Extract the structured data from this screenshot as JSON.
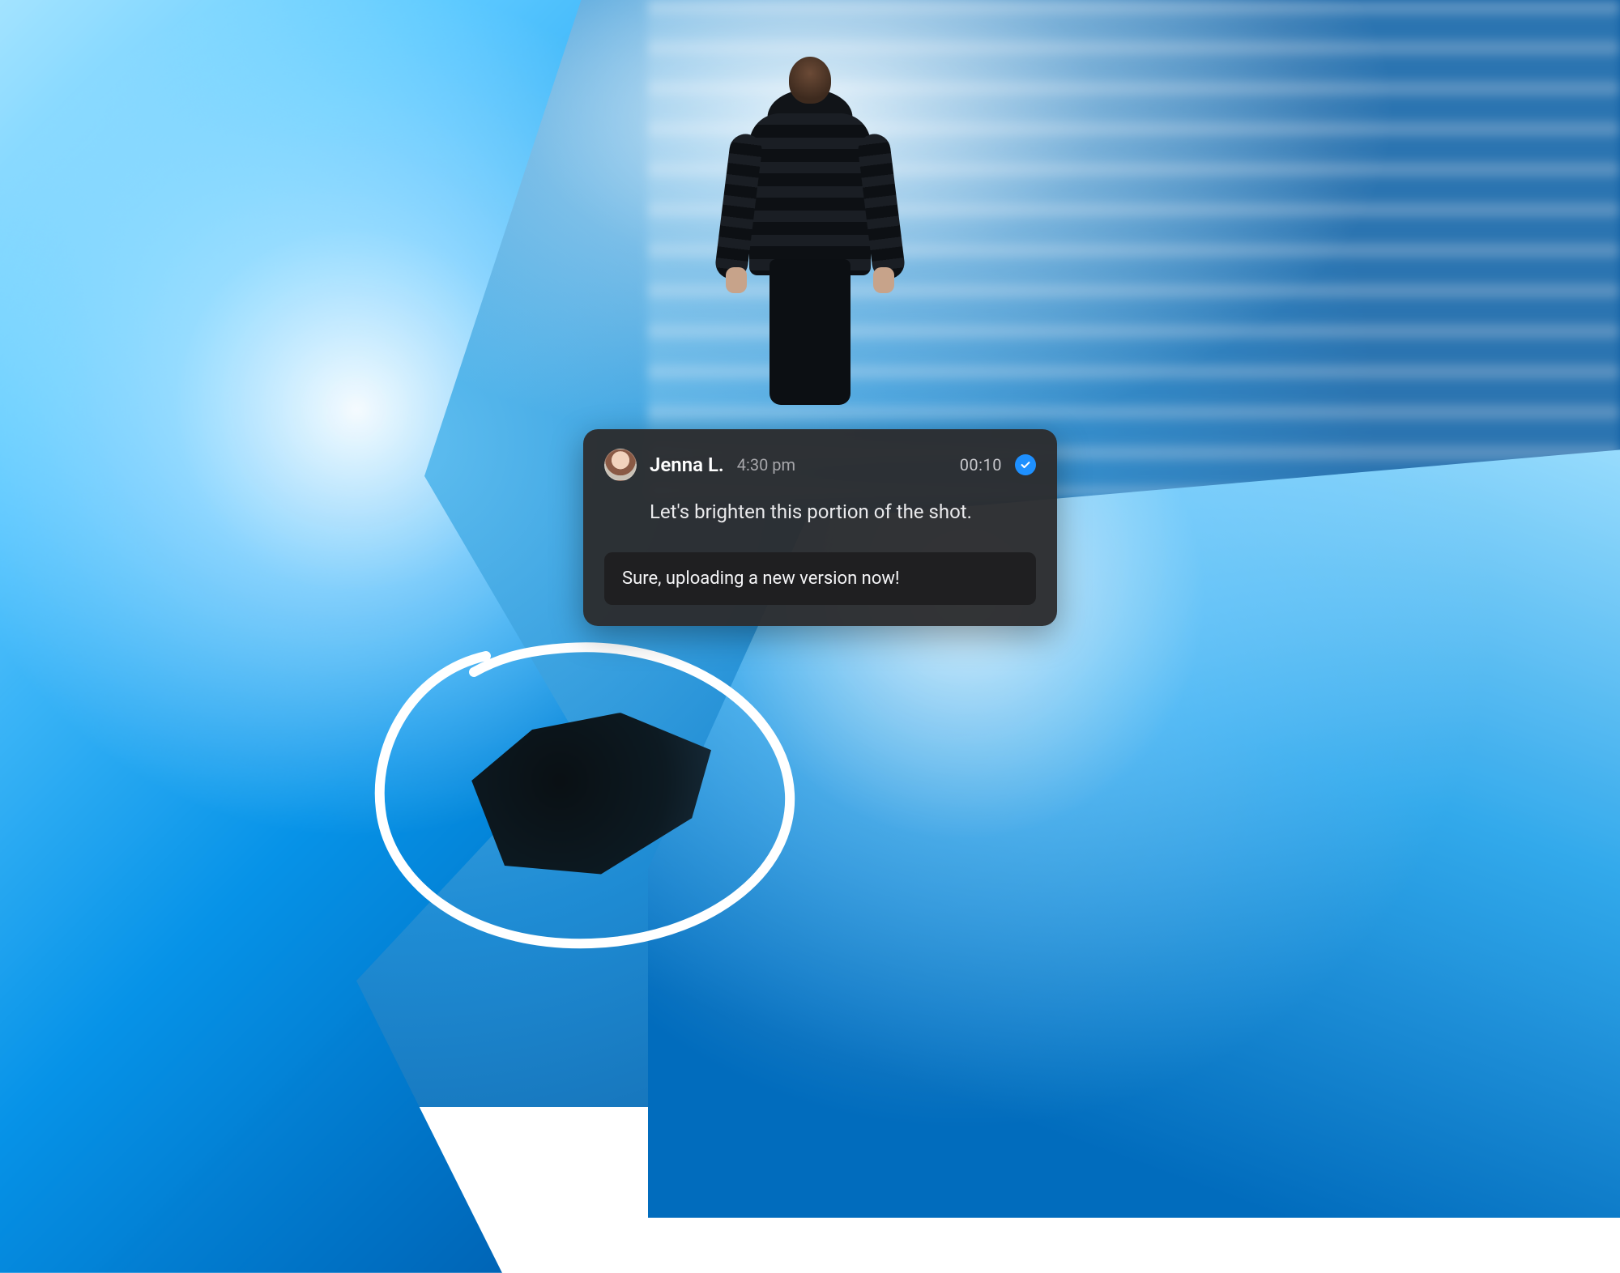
{
  "comment": {
    "author": "Jenna L.",
    "time_posted": "4:30 pm",
    "timecode": "00:10",
    "status_icon": "checkmark",
    "body": "Let's brighten this portion of the shot.",
    "reply_draft": "Sure, uploading a new version now!"
  },
  "annotation": {
    "stroke_color": "#ffffff",
    "shape": "freehand-ellipse"
  }
}
